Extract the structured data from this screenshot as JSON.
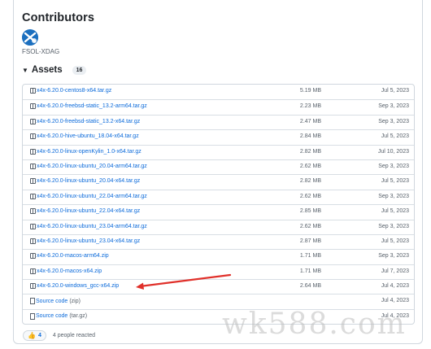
{
  "contributors": {
    "title": "Contributors",
    "name": "FSOL-XDAG"
  },
  "assets": {
    "label": "Assets",
    "count": "16",
    "items": [
      {
        "name": "x4x-6.20.0-centos8-x64.tar.gz",
        "size": "5.19 MB",
        "date": "Jul 5, 2023"
      },
      {
        "name": "x4x-6.20.0-freebsd-static_13.2-arm64.tar.gz",
        "size": "2.23 MB",
        "date": "Sep 3, 2023"
      },
      {
        "name": "x4x-6.20.0-freebsd-static_13.2-x64.tar.gz",
        "size": "2.47 MB",
        "date": "Sep 3, 2023"
      },
      {
        "name": "x4x-6.20.0-hive-ubuntu_18.04-x64.tar.gz",
        "size": "2.84 MB",
        "date": "Jul 5, 2023"
      },
      {
        "name": "x4x-6.20.0-linux-openKylin_1.0-x64.tar.gz",
        "size": "2.82 MB",
        "date": "Jul 10, 2023"
      },
      {
        "name": "x4x-6.20.0-linux-ubuntu_20.04-arm64.tar.gz",
        "size": "2.62 MB",
        "date": "Sep 3, 2023"
      },
      {
        "name": "x4x-6.20.0-linux-ubuntu_20.04-x64.tar.gz",
        "size": "2.82 MB",
        "date": "Jul 5, 2023"
      },
      {
        "name": "x4x-6.20.0-linux-ubuntu_22.04-arm64.tar.gz",
        "size": "2.62 MB",
        "date": "Sep 3, 2023"
      },
      {
        "name": "x4x-6.20.0-linux-ubuntu_22.04-x64.tar.gz",
        "size": "2.85 MB",
        "date": "Jul 5, 2023"
      },
      {
        "name": "x4x-6.20.0-linux-ubuntu_23.04-arm64.tar.gz",
        "size": "2.62 MB",
        "date": "Sep 3, 2023"
      },
      {
        "name": "x4x-6.20.0-linux-ubuntu_23.04-x64.tar.gz",
        "size": "2.87 MB",
        "date": "Jul 5, 2023"
      },
      {
        "name": "x4x-6.20.0-macos-arm64.zip",
        "size": "1.71 MB",
        "date": "Sep 3, 2023"
      },
      {
        "name": "x4x-6.20.0-macos-x64.zip",
        "size": "1.71 MB",
        "date": "Jul 7, 2023"
      },
      {
        "name": "x4x-6.20.0-windows_gcc-x64.zip",
        "size": "2.64 MB",
        "date": "Jul 4, 2023"
      }
    ],
    "sources": [
      {
        "name": "Source code",
        "format": "(zip)",
        "date": "Jul 4, 2023"
      },
      {
        "name": "Source code",
        "format": "(tar.gz)",
        "date": "Jul 4, 2023"
      }
    ]
  },
  "reactions": {
    "emoji": "👍",
    "count": "4",
    "text": "4 people reacted"
  },
  "watermark": "wk588.com",
  "colors": {
    "link": "#0969da",
    "arrow": "#e0302a",
    "avatar": "#1b6fbf"
  },
  "icons": {
    "asset": "package-icon",
    "source": "file-zip-icon",
    "toggle": "triangle-down-icon"
  }
}
